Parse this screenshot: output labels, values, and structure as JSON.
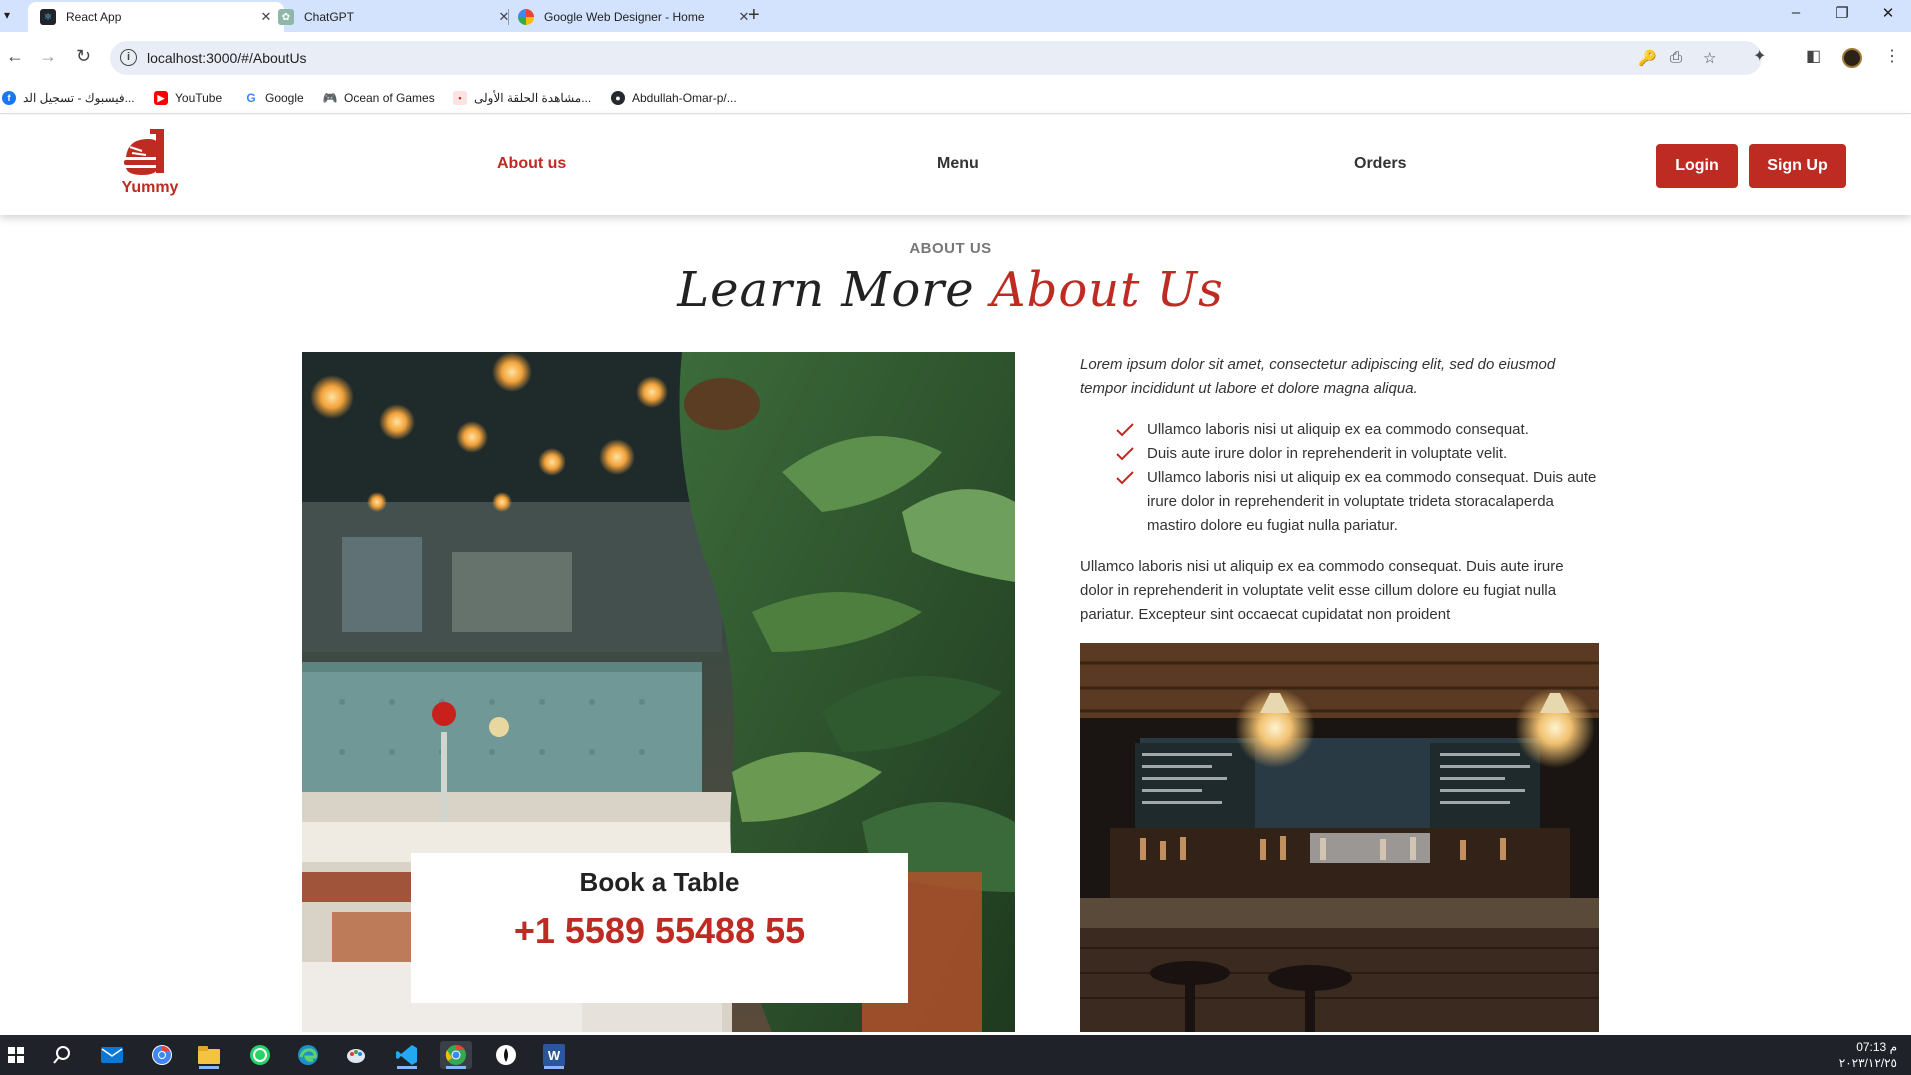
{
  "browser": {
    "tabs": [
      {
        "title": "React App",
        "active": true
      },
      {
        "title": "ChatGPT",
        "active": false
      },
      {
        "title": "Google Web Designer - Home",
        "active": false
      }
    ],
    "url": "localhost:3000/#/AboutUs",
    "bookmarks": [
      {
        "label": "فيسبوك - تسجيل الد...",
        "icon": "facebook-icon"
      },
      {
        "label": "YouTube",
        "icon": "youtube-icon"
      },
      {
        "label": "Google",
        "icon": "google-icon"
      },
      {
        "label": "Ocean of Games",
        "icon": "gamepad-icon"
      },
      {
        "label": "مشاهدة الحلقة الأولى...",
        "icon": "site-icon"
      },
      {
        "label": "Abdullah-Omar-p/...",
        "icon": "github-icon"
      }
    ]
  },
  "site": {
    "logo_text": "Yummy",
    "nav": {
      "about": "About us",
      "menu": "Menu",
      "orders": "Orders"
    },
    "login": "Login",
    "signup": "Sign Up"
  },
  "about": {
    "eyebrow": "ABOUT US",
    "headline_main": "Learn More",
    "headline_accent": "About Us",
    "intro": "Lorem ipsum dolor sit amet, consectetur adipiscing elit, sed do eiusmod tempor incididunt ut labore et dolore magna aliqua.",
    "checks": [
      "Ullamco laboris nisi ut aliquip ex ea commodo consequat.",
      "Duis aute irure dolor in reprehenderit in voluptate velit.",
      "Ullamco laboris nisi ut aliquip ex ea commodo consequat. Duis aute irure dolor in reprehenderit in voluptate trideta storacalaperda mastiro dolore eu fugiat nulla pariatur."
    ],
    "paragraph": "Ullamco laboris nisi ut aliquip ex ea commodo consequat. Duis aute irure dolor in reprehenderit in voluptate velit esse cillum dolore eu fugiat nulla pariatur. Excepteur sint occaecat cupidatat non proident",
    "book_title": "Book a Table",
    "book_phone": "+1 5589 55488 55"
  },
  "taskbar": {
    "time": "07:13 م",
    "date": "٢٠٢٣/١٢/٢٥"
  },
  "colors": {
    "accent": "#be2b22",
    "tabbar": "#d3e3fd",
    "taskbar": "#1f2228"
  }
}
